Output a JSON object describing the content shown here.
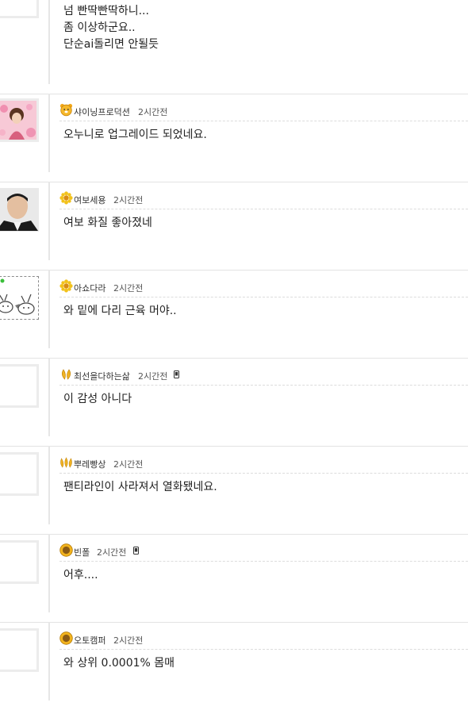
{
  "comments": [
    {
      "author": "",
      "time": "",
      "text": "넘 빤딱빤딱하니...\n좀 이상하군요..\n단순ai돌리면 안될듯",
      "level_icon": "",
      "avatar": "blank",
      "mobile": false
    },
    {
      "author": "샤이닝프로덕션",
      "time": "2시간전",
      "text": "오누니로 업그레이드 되었네요.",
      "level_icon": "bear-face-icon",
      "avatar": "photo-pink",
      "mobile": false
    },
    {
      "author": "여보세용",
      "time": "2시간전",
      "text": "여보 화질 좋아졌네",
      "level_icon": "sunflower-icon",
      "avatar": "photo-man",
      "mobile": false
    },
    {
      "author": "아쇼다라",
      "time": "2시간전",
      "text": "와 밑에 다리 근육 머야..",
      "level_icon": "sunflower-icon",
      "avatar": "cartoon-rabbits",
      "mobile": false
    },
    {
      "author": "최선을다하는삶",
      "time": "2시간전",
      "text": "이 감성 아니다",
      "level_icon": "double-leaf-icon",
      "avatar": "blank",
      "mobile": true
    },
    {
      "author": "뿌레빵상",
      "time": "2시간전",
      "text": "팬티라인이 사라져서 열화됐네요.",
      "level_icon": "triple-leaf-icon",
      "avatar": "blank",
      "mobile": false
    },
    {
      "author": "빈폴",
      "time": "2시간전",
      "text": "어후....",
      "level_icon": "sun-medal-icon",
      "avatar": "blank",
      "mobile": true
    },
    {
      "author": "오토캠퍼",
      "time": "2시간전",
      "text": "와 상위 0.0001% 몸매",
      "level_icon": "sun-medal-icon",
      "avatar": "blank",
      "mobile": false
    }
  ],
  "colors": {
    "divider": "#e3e3e3",
    "thread_line": "#e6e6e6",
    "meta_text": "#555555",
    "body_text": "#222222"
  }
}
